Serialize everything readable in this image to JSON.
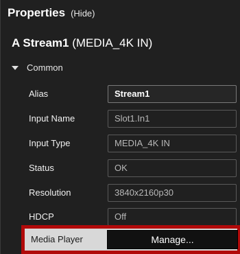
{
  "header": {
    "title": "Properties",
    "hide_label": "(Hide)"
  },
  "stream": {
    "name": "A Stream1",
    "type": "(MEDIA_4K IN)"
  },
  "section": {
    "label": "Common",
    "expanded": true
  },
  "properties": [
    {
      "label": "Alias",
      "value": "Stream1",
      "editable": true
    },
    {
      "label": "Input Name",
      "value": "Slot1.In1",
      "editable": false
    },
    {
      "label": "Input Type",
      "value": "MEDIA_4K IN",
      "editable": false
    },
    {
      "label": "Status",
      "value": "OK",
      "editable": false
    },
    {
      "label": "Resolution",
      "value": "3840x2160p30",
      "editable": false
    },
    {
      "label": "HDCP",
      "value": "Off",
      "editable": false
    }
  ],
  "media_player": {
    "label": "Media Player",
    "button_label": "Manage..."
  },
  "colors": {
    "background": "#202020",
    "highlight_border": "#b10a0a",
    "button_bg": "#111111"
  }
}
